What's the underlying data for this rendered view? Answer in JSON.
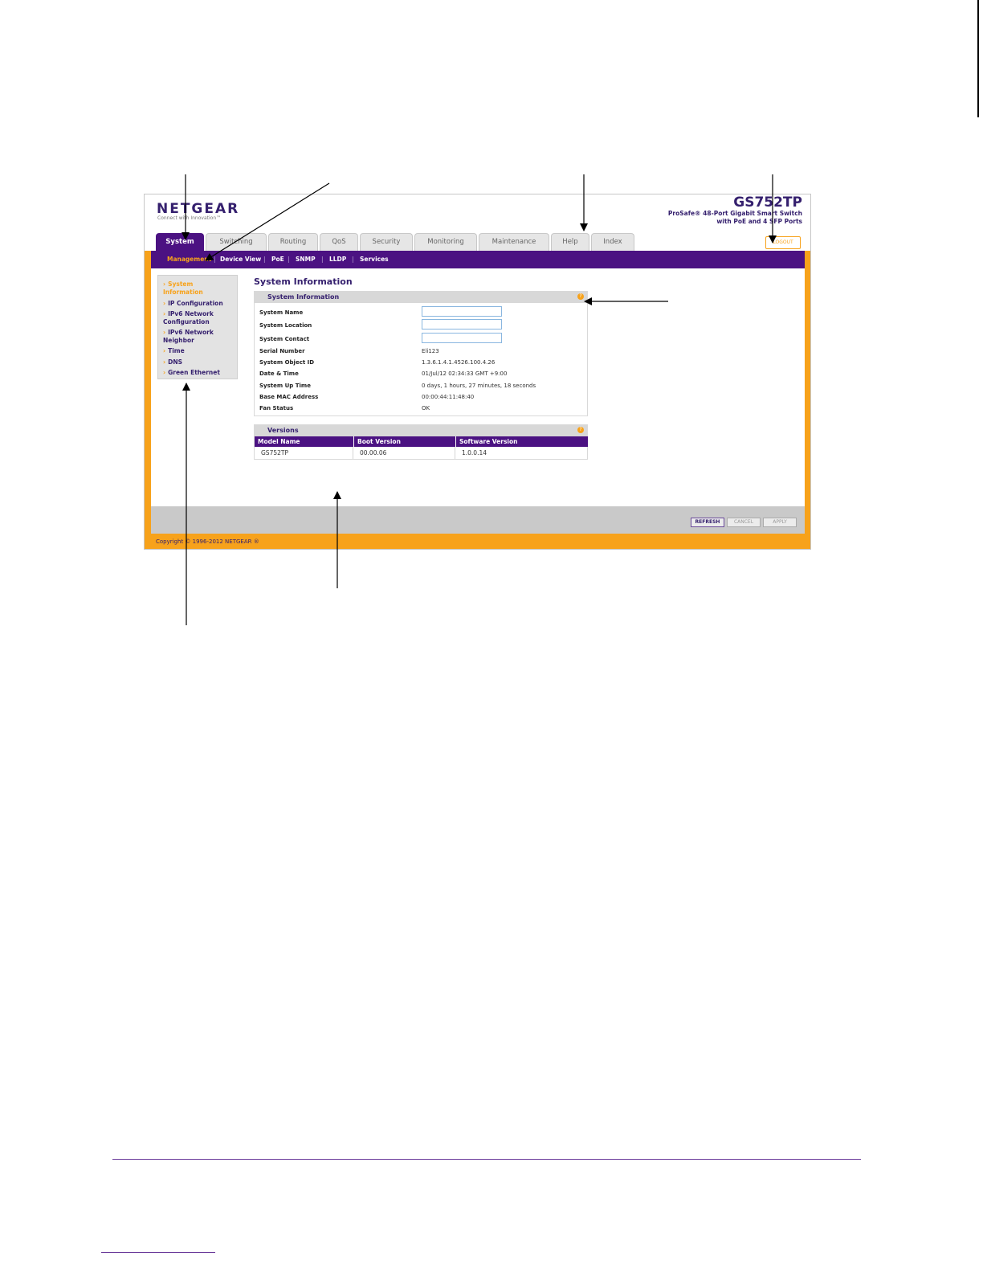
{
  "header": {
    "brand": "NETGEAR",
    "tagline": "Connect with Innovation™",
    "model": "GS752TP",
    "model_desc_line1": "ProSafe® 48-Port Gigabit Smart Switch",
    "model_desc_line2": "with PoE and 4 SFP Ports",
    "logout_label": "LOGOUT"
  },
  "tabs": [
    "System",
    "Switching",
    "Routing",
    "QoS",
    "Security",
    "Monitoring",
    "Maintenance",
    "Help",
    "Index"
  ],
  "subnav": [
    "Management",
    "Device View",
    "PoE",
    "SNMP",
    "LLDP",
    "Services"
  ],
  "leftnav": [
    "System Information",
    "IP Configuration",
    "IPv6 Network Configuration",
    "IPv6 Network Neighbor",
    "Time",
    "DNS",
    "Green Ethernet"
  ],
  "page_title": "System Information",
  "system_info": {
    "title": "System Information",
    "rows": [
      {
        "label": "System Name",
        "value": ""
      },
      {
        "label": "System Location",
        "value": ""
      },
      {
        "label": "System Contact",
        "value": ""
      },
      {
        "label": "Serial Number",
        "value": "Eli123"
      },
      {
        "label": "System Object ID",
        "value": "1.3.6.1.4.1.4526.100.4.26"
      },
      {
        "label": "Date & Time",
        "value": "01/Jul/12  02:34:33 GMT +9:00"
      },
      {
        "label": "System Up Time",
        "value": "0 days, 1 hours, 27 minutes, 18 seconds"
      },
      {
        "label": "Base MAC Address",
        "value": "00:00:44:11:48:40"
      },
      {
        "label": "Fan Status",
        "value": "OK"
      }
    ]
  },
  "versions": {
    "title": "Versions",
    "columns": [
      "Model Name",
      "Boot Version",
      "Software Version"
    ],
    "row": [
      "GS752TP",
      "00.00.06",
      "1.0.0.14"
    ]
  },
  "buttons": {
    "refresh": "REFRESH",
    "cancel": "CANCEL",
    "apply": "APPLY"
  },
  "copyright": "Copyright © 1996-2012 NETGEAR ®",
  "colors": {
    "accent_orange": "#f7a21b",
    "brand_purple": "#4b1282",
    "text_purple": "#35206e"
  }
}
